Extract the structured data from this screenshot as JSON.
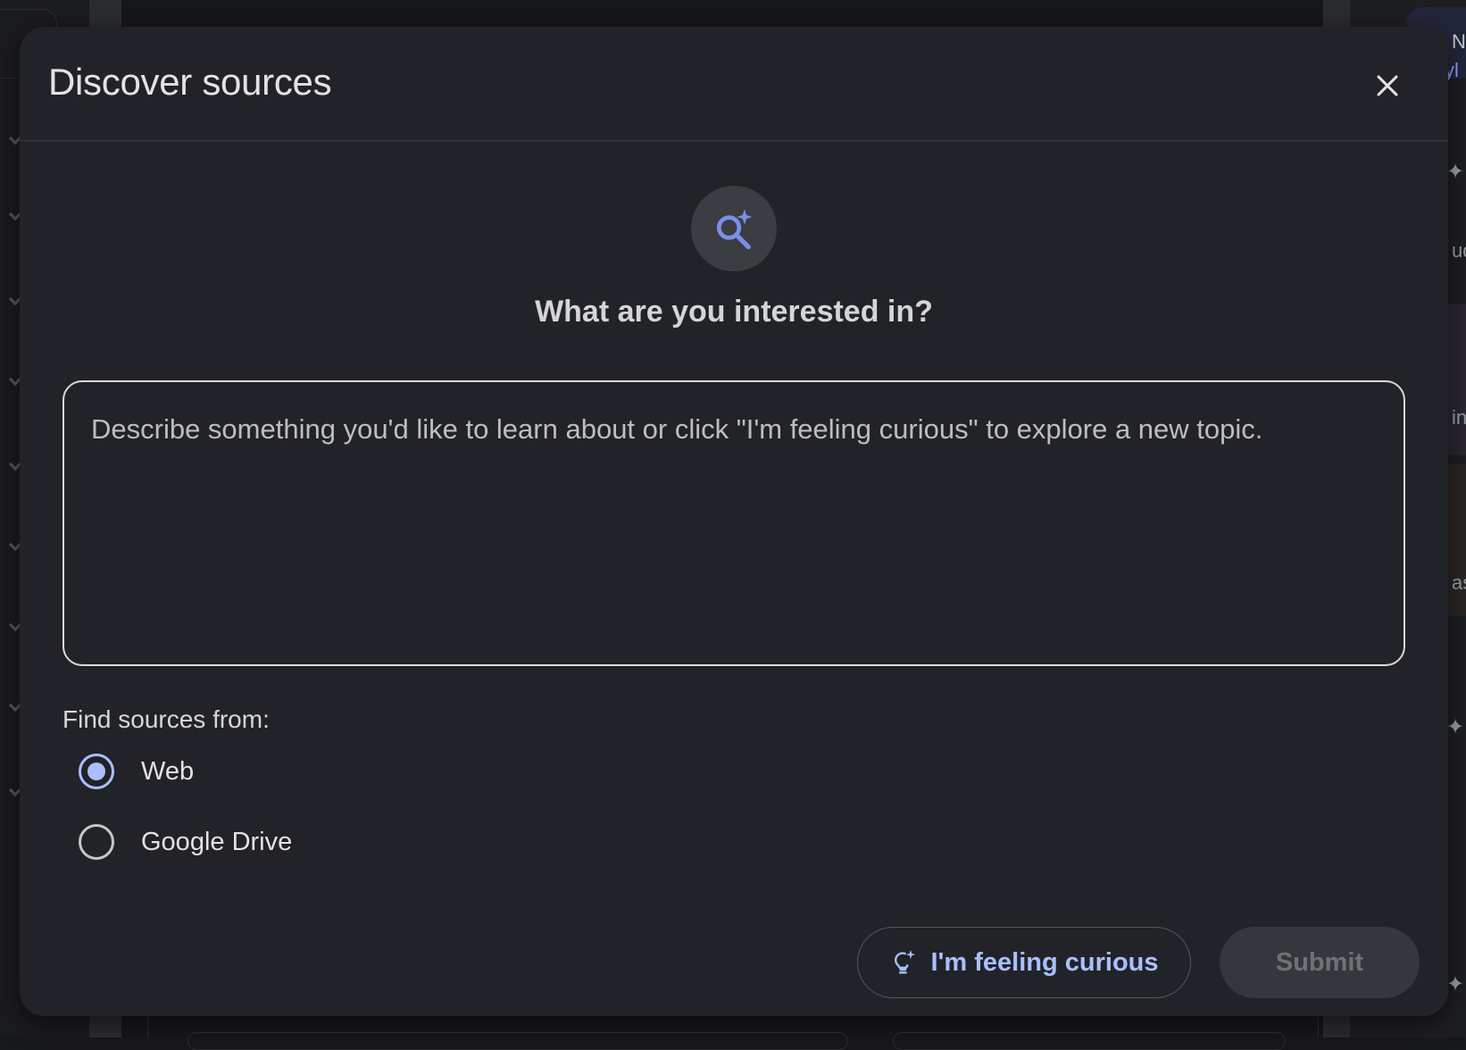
{
  "dialog": {
    "title": "Discover sources",
    "heading": "What are you interested in?",
    "topic_input": {
      "value": "",
      "placeholder": "Describe something you'd like to learn about or click \"I'm feeling curious\" to explore a new topic."
    },
    "find_sources_label": "Find sources from:",
    "source_options": [
      {
        "label": "Web",
        "checked": true
      },
      {
        "label": "Google Drive",
        "checked": false
      }
    ],
    "curious_button_label": "I'm feeling curious",
    "submit_button_label": "Submit"
  },
  "background": {
    "right_panel_fragments": [
      "N",
      "yl",
      "ud",
      "in",
      "as"
    ]
  },
  "colors": {
    "accent": "#a8c0ff",
    "hero_icon": "#7b8fe8",
    "dialog_bg": "#212328",
    "submit_disabled_bg": "#35373c"
  },
  "icons": {
    "close": "close-icon",
    "hero": "search-sparkle-icon",
    "curious": "lightbulb-sparkle-icon"
  }
}
